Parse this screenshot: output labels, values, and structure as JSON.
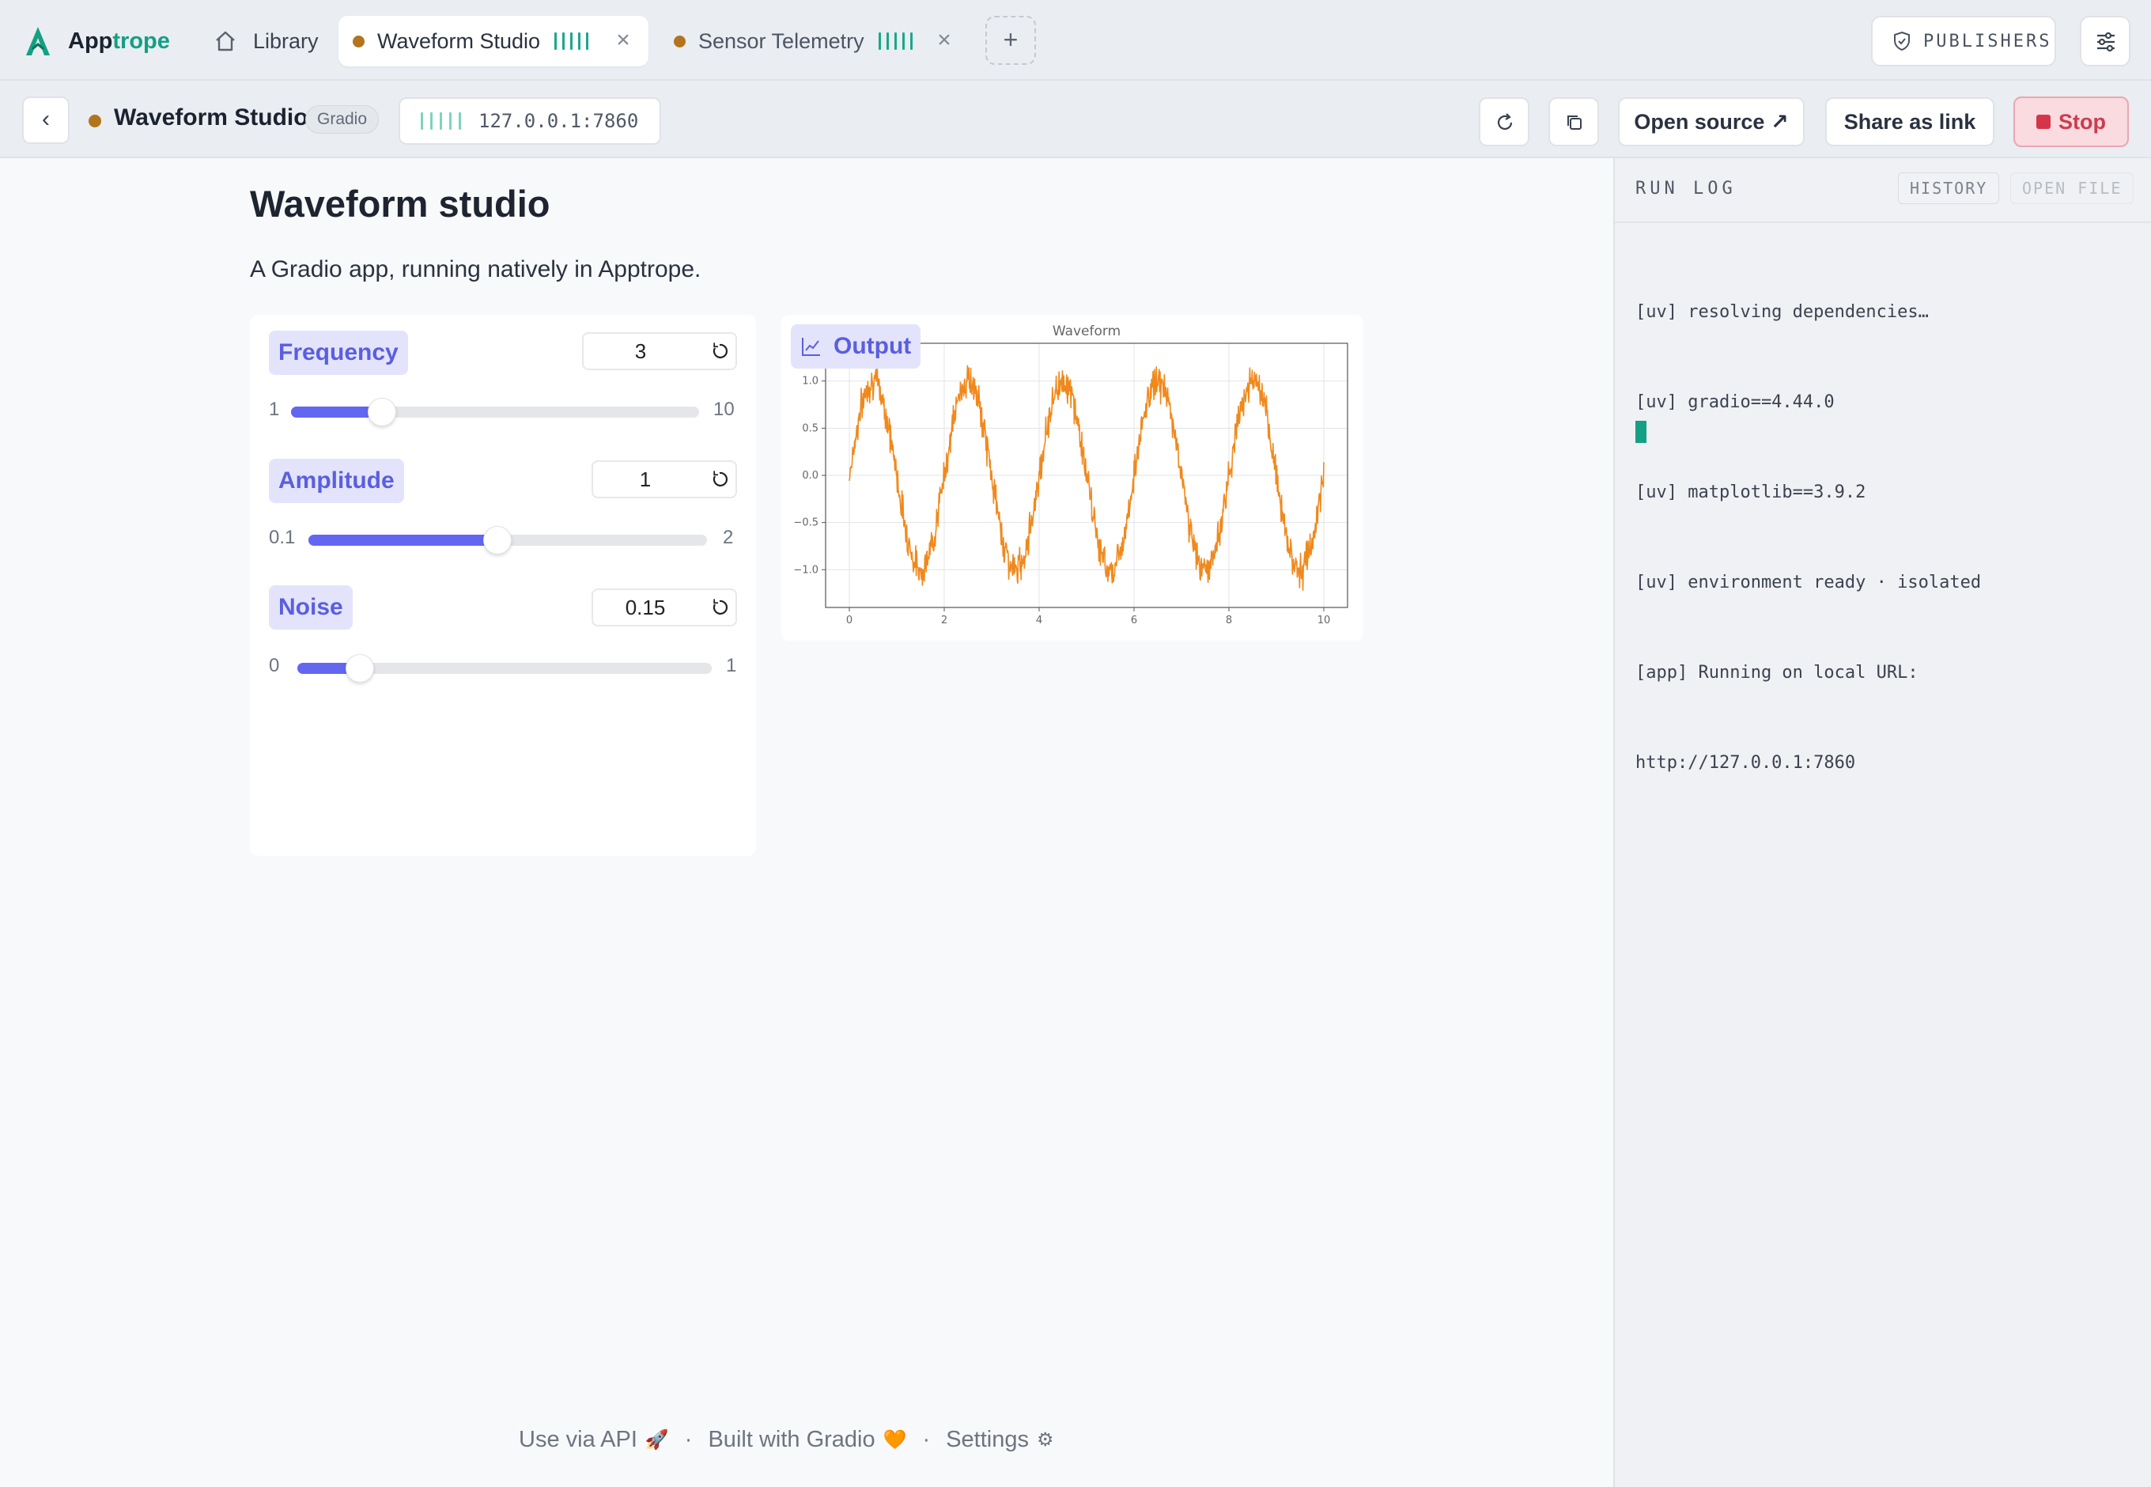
{
  "brand": {
    "name_prefix": "App",
    "name_suffix": "trope"
  },
  "tabs": {
    "library": "Library",
    "active": "Waveform Studio",
    "inactive": "Sensor Telemetry",
    "close_glyph": "×",
    "add_glyph": "+"
  },
  "top_actions": {
    "publishers": "PUBLISHERS"
  },
  "toolbar": {
    "back_glyph": "‹",
    "app_title": "Waveform Studio",
    "framework": "Gradio",
    "url": "127.0.0.1:7860",
    "open_source": "Open source ↗",
    "share": "Share as link",
    "stop": "Stop"
  },
  "app": {
    "title": "Waveform studio",
    "subtitle": "A Gradio app, running natively in Apptrope.",
    "controls": [
      {
        "label": "Frequency",
        "value": "3",
        "min": "1",
        "max": "10",
        "fraction": 0.2222
      },
      {
        "label": "Amplitude",
        "value": "1",
        "min": "0.1",
        "max": "2",
        "fraction": 0.4737
      },
      {
        "label": "Noise",
        "value": "0.15",
        "min": "0",
        "max": "1",
        "fraction": 0.15
      }
    ],
    "output_label": "Output"
  },
  "chart_data": {
    "type": "line",
    "title": "Waveform",
    "xlim": [
      -0.5,
      10.5
    ],
    "ylim": [
      -1.4,
      1.4
    ],
    "xticks": [
      "0",
      "2",
      "4",
      "6",
      "8",
      "10"
    ],
    "yticks": [
      "1.0",
      "0.5",
      "0.0",
      "−0.5",
      "−1.0"
    ],
    "grid": true,
    "series": [
      {
        "function": "amplitude * sin(2*pi*frequency*x/6)",
        "frequency": 3,
        "amplitude": 1,
        "noise": 0.15,
        "x_range": [
          0,
          10
        ],
        "color": "#f0891d"
      }
    ]
  },
  "footer": {
    "api": "Use via API",
    "api_emoji": "🚀",
    "built": "Built with Gradio",
    "built_emoji": "🧡",
    "settings": "Settings",
    "settings_emoji": "⚙",
    "sep": "·"
  },
  "runlog": {
    "title": "RUN LOG",
    "history": "HISTORY",
    "open_file": "OPEN FILE",
    "lines": [
      "[uv] resolving dependencies…",
      "[uv] gradio==4.44.0",
      "[uv] matplotlib==3.9.2",
      "[uv] environment ready · isolated",
      "[app] Running on local URL:",
      "http://127.0.0.1:7860"
    ]
  },
  "colors": {
    "accent": "#13a083",
    "gradio": "#6366f1",
    "plot_line": "#f0891d",
    "stop": "#d53548"
  }
}
